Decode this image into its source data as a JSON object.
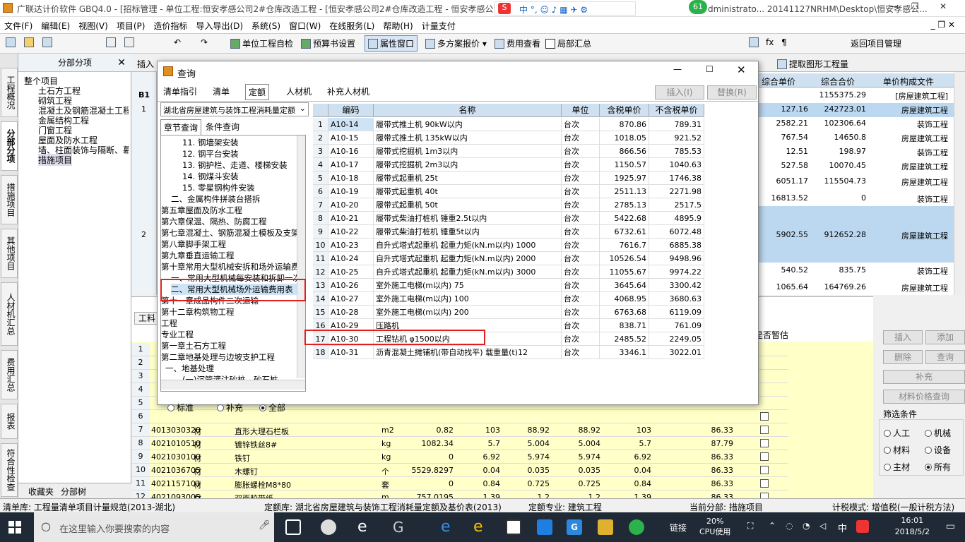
{
  "window": {
    "title": "广联达计价软件 GBQ4.0 - [招标管理 - 单位工程:恒安孝感公司2#仓库改造工程 - [恒安孝感公司2#仓库改造工程 - 恒安孝感公司2#...",
    "title_right": "dministrato... 20141127NRHM\\Desktop\\恒安孝感公...",
    "badge": "61"
  },
  "menu": [
    "文件(F)",
    "编辑(E)",
    "视图(V)",
    "项目(P)",
    "造价指标",
    "导入导出(D)",
    "系统(S)",
    "窗口(W)",
    "在线服务(L)",
    "帮助(H)",
    "计量支付"
  ],
  "toolbar": {
    "self_check": "单位工程自检",
    "budget_settings": "预算书设置",
    "property_window": "属性窗口",
    "multi_scheme": "多方案报价",
    "fee_view": "费用查看",
    "partial_summary": "局部汇总",
    "return_project": "返回项目管理",
    "extract_graph": "提取图形工程量"
  },
  "left_tabs": [
    "工程概况",
    "分部分项",
    "措施项目",
    "其他项目",
    "人材机汇总",
    "费用汇总",
    "报表",
    "符合性检查"
  ],
  "tree_panel": {
    "title": "分部分项",
    "items": [
      "整个项目",
      "土石方工程",
      "砌筑工程",
      "混凝土及钢筋混凝土工程",
      "金属结构工程",
      "门窗工程",
      "屋面及防水工程",
      "墙、柱面装饰与隔断、幕墙",
      "措施项目"
    ],
    "bottom_tabs": [
      "收藏夹",
      "分部树"
    ]
  },
  "bg_table": {
    "headers": [
      "综合单价",
      "综合合价",
      "单价构成文件"
    ],
    "b1_label": "B1",
    "rows": [
      {
        "no": "",
        "unit_price": "",
        "total": "1155375.29",
        "file": "[房屋建筑工程]"
      },
      {
        "no": "1",
        "unit_price": "127.16",
        "total": "242723.01",
        "file": "房屋建筑工程"
      },
      {
        "no": "",
        "unit_price": "2582.21",
        "total": "102306.64",
        "file": "装饰工程"
      },
      {
        "no": "",
        "unit_price": "767.54",
        "total": "14650.8",
        "file": "房屋建筑工程"
      },
      {
        "no": "",
        "unit_price": "12.51",
        "total": "198.97",
        "file": "装饰工程"
      },
      {
        "no": "",
        "unit_price": "527.58",
        "total": "10070.45",
        "file": "房屋建筑工程"
      },
      {
        "no": "",
        "unit_price": "6051.17",
        "total": "115504.73",
        "file": "房屋建筑工程"
      },
      {
        "no": "",
        "unit_price": "16813.52",
        "total": "0",
        "file": "装饰工程"
      },
      {
        "no": "2",
        "unit_price": "5902.55",
        "total": "912652.28",
        "file": "房屋建筑工程"
      },
      {
        "no": "",
        "unit_price": "540.52",
        "total": "835.75",
        "file": "装饰工程"
      },
      {
        "no": "",
        "unit_price": "1065.64",
        "total": "164769.26",
        "file": "房屋建筑工程"
      }
    ]
  },
  "lower_table": {
    "tab_label": "工料",
    "temp_label": "是否暂估",
    "rows": [
      {
        "no": "1"
      },
      {
        "no": "2"
      },
      {
        "no": "3"
      },
      {
        "no": "4"
      },
      {
        "no": "5"
      },
      {
        "no": "6"
      },
      {
        "no": "7",
        "code": "4013030320",
        "type": "材",
        "name": "直形大理石栏板",
        "unit": "m2",
        "a": "0.82",
        "b": "103",
        "c": "88.92",
        "d": "88.92",
        "e": "103",
        "f": "86.33"
      },
      {
        "no": "8",
        "code": "4021010510",
        "type": "材",
        "name": "镀锌铁丝8#",
        "unit": "kg",
        "a": "1082.34",
        "b": "5.7",
        "c": "5.004",
        "d": "5.004",
        "e": "5.7",
        "f": "87.79"
      },
      {
        "no": "9",
        "code": "4021030100",
        "type": "材",
        "name": "铁钉",
        "unit": "kg",
        "a": "0",
        "b": "6.92",
        "c": "5.974",
        "d": "5.974",
        "e": "6.92",
        "f": "86.33"
      },
      {
        "no": "10",
        "code": "4021036705",
        "type": "材",
        "name": "木螺钉",
        "unit": "个",
        "a": "5529.8297",
        "b": "0.04",
        "c": "0.035",
        "d": "0.035",
        "e": "0.04",
        "f": "86.33"
      },
      {
        "no": "11",
        "code": "4021157101",
        "type": "材",
        "name": "膨胀螺栓M8*80",
        "unit": "套",
        "a": "0",
        "b": "0.84",
        "c": "0.725",
        "d": "0.725",
        "e": "0.84",
        "f": "86.33"
      },
      {
        "no": "12",
        "code": "4021093005",
        "type": "材",
        "name": "双面胶带纸",
        "unit": "m",
        "a": "757.0195",
        "b": "1.39",
        "c": "1.2",
        "d": "1.2",
        "e": "1.39",
        "f": "86.33"
      }
    ]
  },
  "right_panel": {
    "insert": "插入",
    "add": "添加",
    "delete": "删除",
    "query": "查询",
    "supplement": "补充",
    "price_query": "材料价格查询",
    "filter_title": "筛选条件",
    "filters": [
      "人工",
      "机械",
      "材料",
      "设备",
      "主材",
      "所有"
    ]
  },
  "dialog": {
    "title": "查询",
    "tabs": [
      "清单指引",
      "清单",
      "定额",
      "人材机",
      "补充人材机"
    ],
    "insert_btn": "插入(I)",
    "replace_btn": "替换(R)",
    "dropdown": "湖北省房屋建筑与装饰工程消耗量定额",
    "subtabs": [
      "章节查询",
      "条件查询"
    ],
    "tree": [
      "11. 钢墙架安装",
      "12. 钢平台安装",
      "13. 钢护栏、走道、楼梯安装",
      "14. 钢煤斗安装",
      "15. 零星钢构件安装",
      "二、金属构件拼装台搭拆",
      "第五章屋面及防水工程",
      "第六章保温、隔热、防腐工程",
      "第七章混凝土、钢筋混凝土模板及支架",
      "第八章脚手架工程",
      "第九章垂直运输工程",
      "第十章常用大型机械安拆和场外运输费用",
      "一、常用大型机械每安装和拆卸一次",
      "二、常用大型机械场外运输费用表",
      "第十一章成品构件二次运输",
      "第十二章构筑物工程",
      "工程",
      "专业工程",
      "第一章土石方工程",
      "第二章地基处理与边坡支护工程",
      "一、地基处理",
      "(一)沉管灌注砂桩、砂石桩"
    ],
    "radio": [
      "标准",
      "补充",
      "全部"
    ],
    "columns": [
      "编码",
      "名称",
      "单位",
      "含税单价",
      "不含税单价"
    ],
    "rows": [
      {
        "no": "1",
        "code": "A10-14",
        "name": "履带式推土机 90kW以内",
        "unit": "台次",
        "p1": "870.86",
        "p2": "789.31"
      },
      {
        "no": "2",
        "code": "A10-15",
        "name": "履带式推土机 135kW以内",
        "unit": "台次",
        "p1": "1018.05",
        "p2": "921.52"
      },
      {
        "no": "3",
        "code": "A10-16",
        "name": "履带式挖掘机 1m3以内",
        "unit": "台次",
        "p1": "866.56",
        "p2": "785.53"
      },
      {
        "no": "4",
        "code": "A10-17",
        "name": "履带式挖掘机 2m3以内",
        "unit": "台次",
        "p1": "1150.57",
        "p2": "1040.63"
      },
      {
        "no": "5",
        "code": "A10-18",
        "name": "履带式起重机 25t",
        "unit": "台次",
        "p1": "1925.97",
        "p2": "1746.38"
      },
      {
        "no": "6",
        "code": "A10-19",
        "name": "履带式起重机 40t",
        "unit": "台次",
        "p1": "2511.13",
        "p2": "2271.98"
      },
      {
        "no": "7",
        "code": "A10-20",
        "name": "履带式起重机 50t",
        "unit": "台次",
        "p1": "2785.13",
        "p2": "2517.5"
      },
      {
        "no": "8",
        "code": "A10-21",
        "name": "履带式柴油打桩机 锤重2.5t以内",
        "unit": "台次",
        "p1": "5422.68",
        "p2": "4895.9"
      },
      {
        "no": "9",
        "code": "A10-22",
        "name": "履带式柴油打桩机 锤重5t以内",
        "unit": "台次",
        "p1": "6732.61",
        "p2": "6072.48"
      },
      {
        "no": "10",
        "code": "A10-23",
        "name": "自升式塔式起重机 起重力矩(kN.m以内) 1000",
        "unit": "台次",
        "p1": "7616.7",
        "p2": "6885.38"
      },
      {
        "no": "11",
        "code": "A10-24",
        "name": "自升式塔式起重机 起重力矩(kN.m以内) 2000",
        "unit": "台次",
        "p1": "10526.54",
        "p2": "9498.96"
      },
      {
        "no": "12",
        "code": "A10-25",
        "name": "自升式塔式起重机 起重力矩(kN.m以内) 3000",
        "unit": "台次",
        "p1": "11055.67",
        "p2": "9974.22"
      },
      {
        "no": "13",
        "code": "A10-26",
        "name": "室外施工电梯(m以内) 75",
        "unit": "台次",
        "p1": "3645.64",
        "p2": "3300.42"
      },
      {
        "no": "14",
        "code": "A10-27",
        "name": "室外施工电梯(m以内) 100",
        "unit": "台次",
        "p1": "4068.95",
        "p2": "3680.63"
      },
      {
        "no": "15",
        "code": "A10-28",
        "name": "室外施工电梯(m以内) 200",
        "unit": "台次",
        "p1": "6763.68",
        "p2": "6119.09"
      },
      {
        "no": "16",
        "code": "A10-29",
        "name": "压路机",
        "unit": "台次",
        "p1": "838.71",
        "p2": "761.09"
      },
      {
        "no": "17",
        "code": "A10-30",
        "name": "工程钻机 φ1500以内",
        "unit": "台次",
        "p1": "2485.52",
        "p2": "2249.05"
      },
      {
        "no": "18",
        "code": "A10-31",
        "name": "沥青混凝土摊铺机(带自动找平) 载重量(t)12",
        "unit": "台次",
        "p1": "3346.1",
        "p2": "3022.01"
      }
    ]
  },
  "status": {
    "list_lib": "清单库:  工程量清单项目计量规范(2013-湖北)",
    "quota_lib": "定额库:  湖北省房屋建筑与装饰工程消耗量定额及基价表(2013)",
    "specialty": "定额专业:  建筑工程",
    "current": "当前分部:  措施项目",
    "tax_mode": "计税模式:  增值税(一般计税方法)"
  },
  "taskbar": {
    "search_placeholder": "在这里输入你要搜索的内容",
    "net_label": "链接",
    "cpu": "20%",
    "cpu_label": "CPU使用",
    "ime": "中",
    "time": "16:01",
    "date": "2018/5/2"
  }
}
